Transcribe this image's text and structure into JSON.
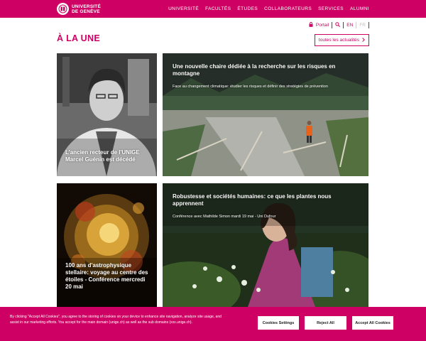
{
  "header": {
    "logo_line1": "UNIVERSITÉ",
    "logo_line2": "DE GENÈVE",
    "nav": [
      "UNIVERSITÉ",
      "FACULTÉS",
      "ÉTUDES",
      "COLLABORATEURS",
      "SERVICES",
      "ALUMNI"
    ]
  },
  "utility": {
    "portal_label": "Portail",
    "lang_en": "EN",
    "lang_fr": "FR"
  },
  "section": {
    "title": "À LA UNE",
    "all_news_label": "toutes les actualités"
  },
  "cards": [
    {
      "title": "L'ancien recteur de l'UNIGE Marcel Guénin est décédé"
    },
    {
      "title": "Une nouvelle chaire dédiée à la recherche sur les risques en montagne",
      "subtitle": "Face au changement climatique: étudier les risques et définir des stratégies de prévention"
    },
    {
      "title": "100 ans d'astrophysique stellaire: voyage au centre des étoiles - Conférence mercredi 20 mai"
    },
    {
      "title": "Robustesse et sociétés humaines: ce que les plantes nous apprennent",
      "subtitle": "Conférence avec Mathilde Simon mardi 19 mai - Uni Dufour"
    }
  ],
  "cookie": {
    "text": "By clicking \"Accept All Cookies\", you agree to the storing of cookies on your device to enhance site navigation, analyze site usage, and assist in our marketing efforts. You accept for the main domain (unige.ch) as well as the sub domains (xxx.unige.ch).",
    "settings_label": "Cookies Settings",
    "reject_label": "Reject All",
    "accept_label": "Accept All Cookies"
  },
  "colors": {
    "brand": "#cf0063"
  },
  "icons": [
    "unige-logo-icon",
    "lock-icon",
    "search-icon",
    "chevron-right-icon"
  ]
}
